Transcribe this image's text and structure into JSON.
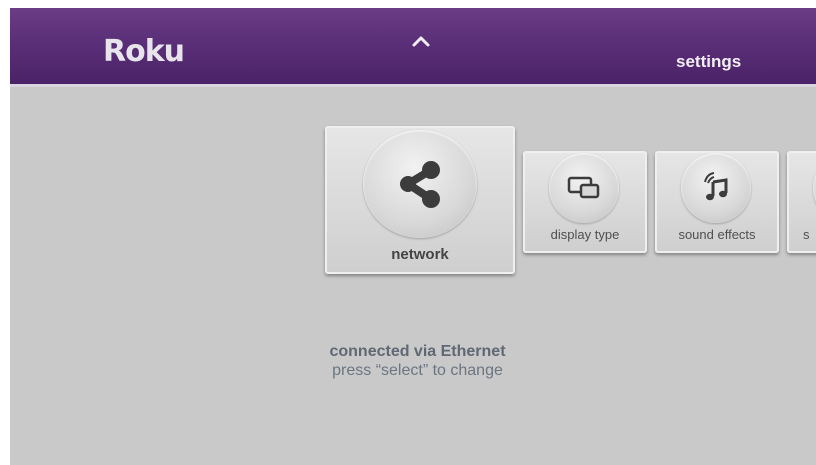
{
  "header": {
    "logo_text": "Roku",
    "title": "settings",
    "up_arrow_icon": "chevron-up-icon"
  },
  "tiles": [
    {
      "label": "network",
      "icon": "share-network-icon",
      "selected": true
    },
    {
      "label": "display type",
      "icon": "display-screens-icon",
      "selected": false
    },
    {
      "label": "sound effects",
      "icon": "music-note-sound-icon",
      "selected": false
    },
    {
      "label": "s",
      "icon": "partial-icon",
      "selected": false
    }
  ],
  "status": {
    "line1": "connected via Ethernet",
    "line2": "press “select” to change"
  },
  "colors": {
    "header_purple": "#5b2f78",
    "background_gray": "#c9c9c9"
  }
}
